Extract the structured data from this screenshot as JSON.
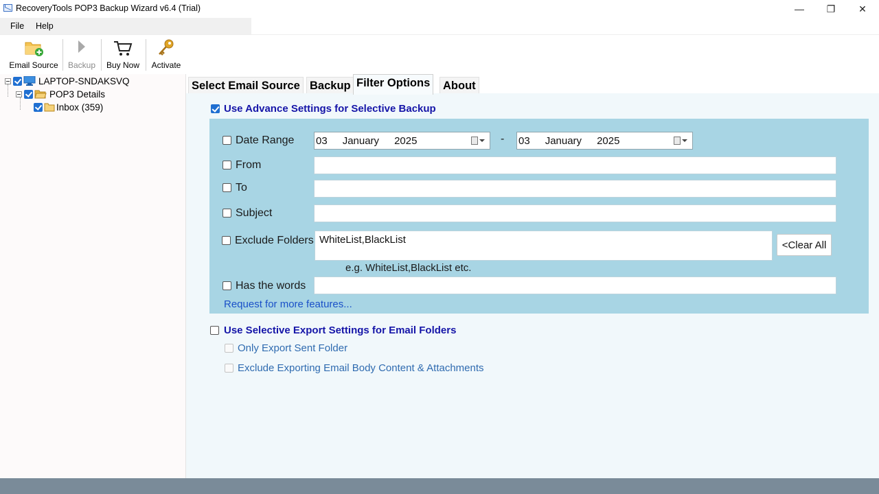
{
  "window": {
    "title": "RecoveryTools POP3 Backup Wizard v6.4 (Trial)",
    "minimize": "—",
    "restore": "❐",
    "close": "✕"
  },
  "menu": {
    "file": "File",
    "help": "Help"
  },
  "toolbar": {
    "email_source": "Email Source",
    "backup": "Backup",
    "buy_now": "Buy Now",
    "activate": "Activate"
  },
  "tree": {
    "root": "LAPTOP-SNDAKSVQ",
    "account": "POP3 Details",
    "folder": "Inbox (359)"
  },
  "tabs": {
    "select_source": "Select Email Source",
    "backup": "Backup",
    "filter_options": "Filter Options",
    "about": "About"
  },
  "filter": {
    "advance_heading": "Use Advance Settings for Selective Backup",
    "advance_checked": true,
    "date_range_label": "Date Range",
    "date_from": {
      "day": "03",
      "month": "January",
      "year": "2025"
    },
    "date_separator": "-",
    "date_to": {
      "day": "03",
      "month": "January",
      "year": "2025"
    },
    "from_label": "From",
    "to_label": "To",
    "subject_label": "Subject",
    "exclude_label": "Exclude Folders",
    "exclude_value": "WhiteList,BlackList",
    "clear_all": "<Clear All",
    "exclude_hint": "e.g. WhiteList,BlackList etc.",
    "has_words_label": "Has the words",
    "request_link": "Request for more features..."
  },
  "export": {
    "heading": "Use Selective Export Settings for Email Folders",
    "only_sent": "Only Export Sent Folder",
    "exclude_body": "Exclude Exporting Email Body Content & Attachments"
  },
  "colors": {
    "accent": "#1f6fd1",
    "heading_text": "#1515a8",
    "filter_box": "#a8d5e4",
    "content_bg": "#f1f8fb",
    "status_bar": "#7a8b99"
  }
}
